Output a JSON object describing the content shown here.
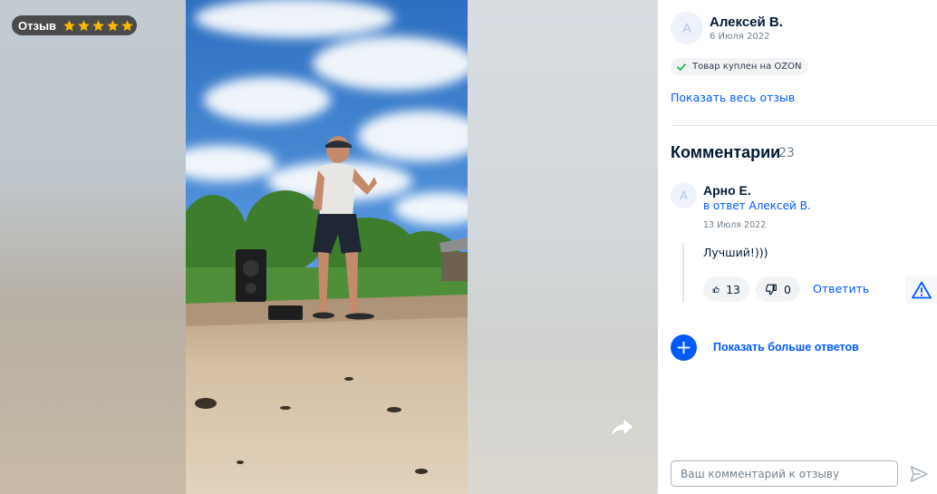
{
  "media": {
    "badge_label": "Отзыв",
    "rating": 5,
    "star_color": "#ffb800",
    "share_icon": "share-arrow-icon"
  },
  "review": {
    "author_initial": "А",
    "author_name": "Алексей В.",
    "date": "6 Июля 2022",
    "purchased_label": "Товар куплен на OZON",
    "show_full_label": "Показать весь отзыв"
  },
  "comments": {
    "title": "Комментарии",
    "count": "23",
    "items": [
      {
        "initial": "А",
        "name": "Арно Е.",
        "reply_to": "в ответ Алексей В.",
        "date": "13 Июля 2022",
        "text": "Лучший!)))",
        "likes": "13",
        "dislikes": "0",
        "reply_label": "Ответить"
      }
    ],
    "show_more_label": "Показать больше ответов"
  },
  "composer": {
    "placeholder": "Ваш комментарий к отзыву"
  },
  "colors": {
    "accent": "#005bff",
    "text": "#001a34",
    "muted": "#707f8d"
  }
}
